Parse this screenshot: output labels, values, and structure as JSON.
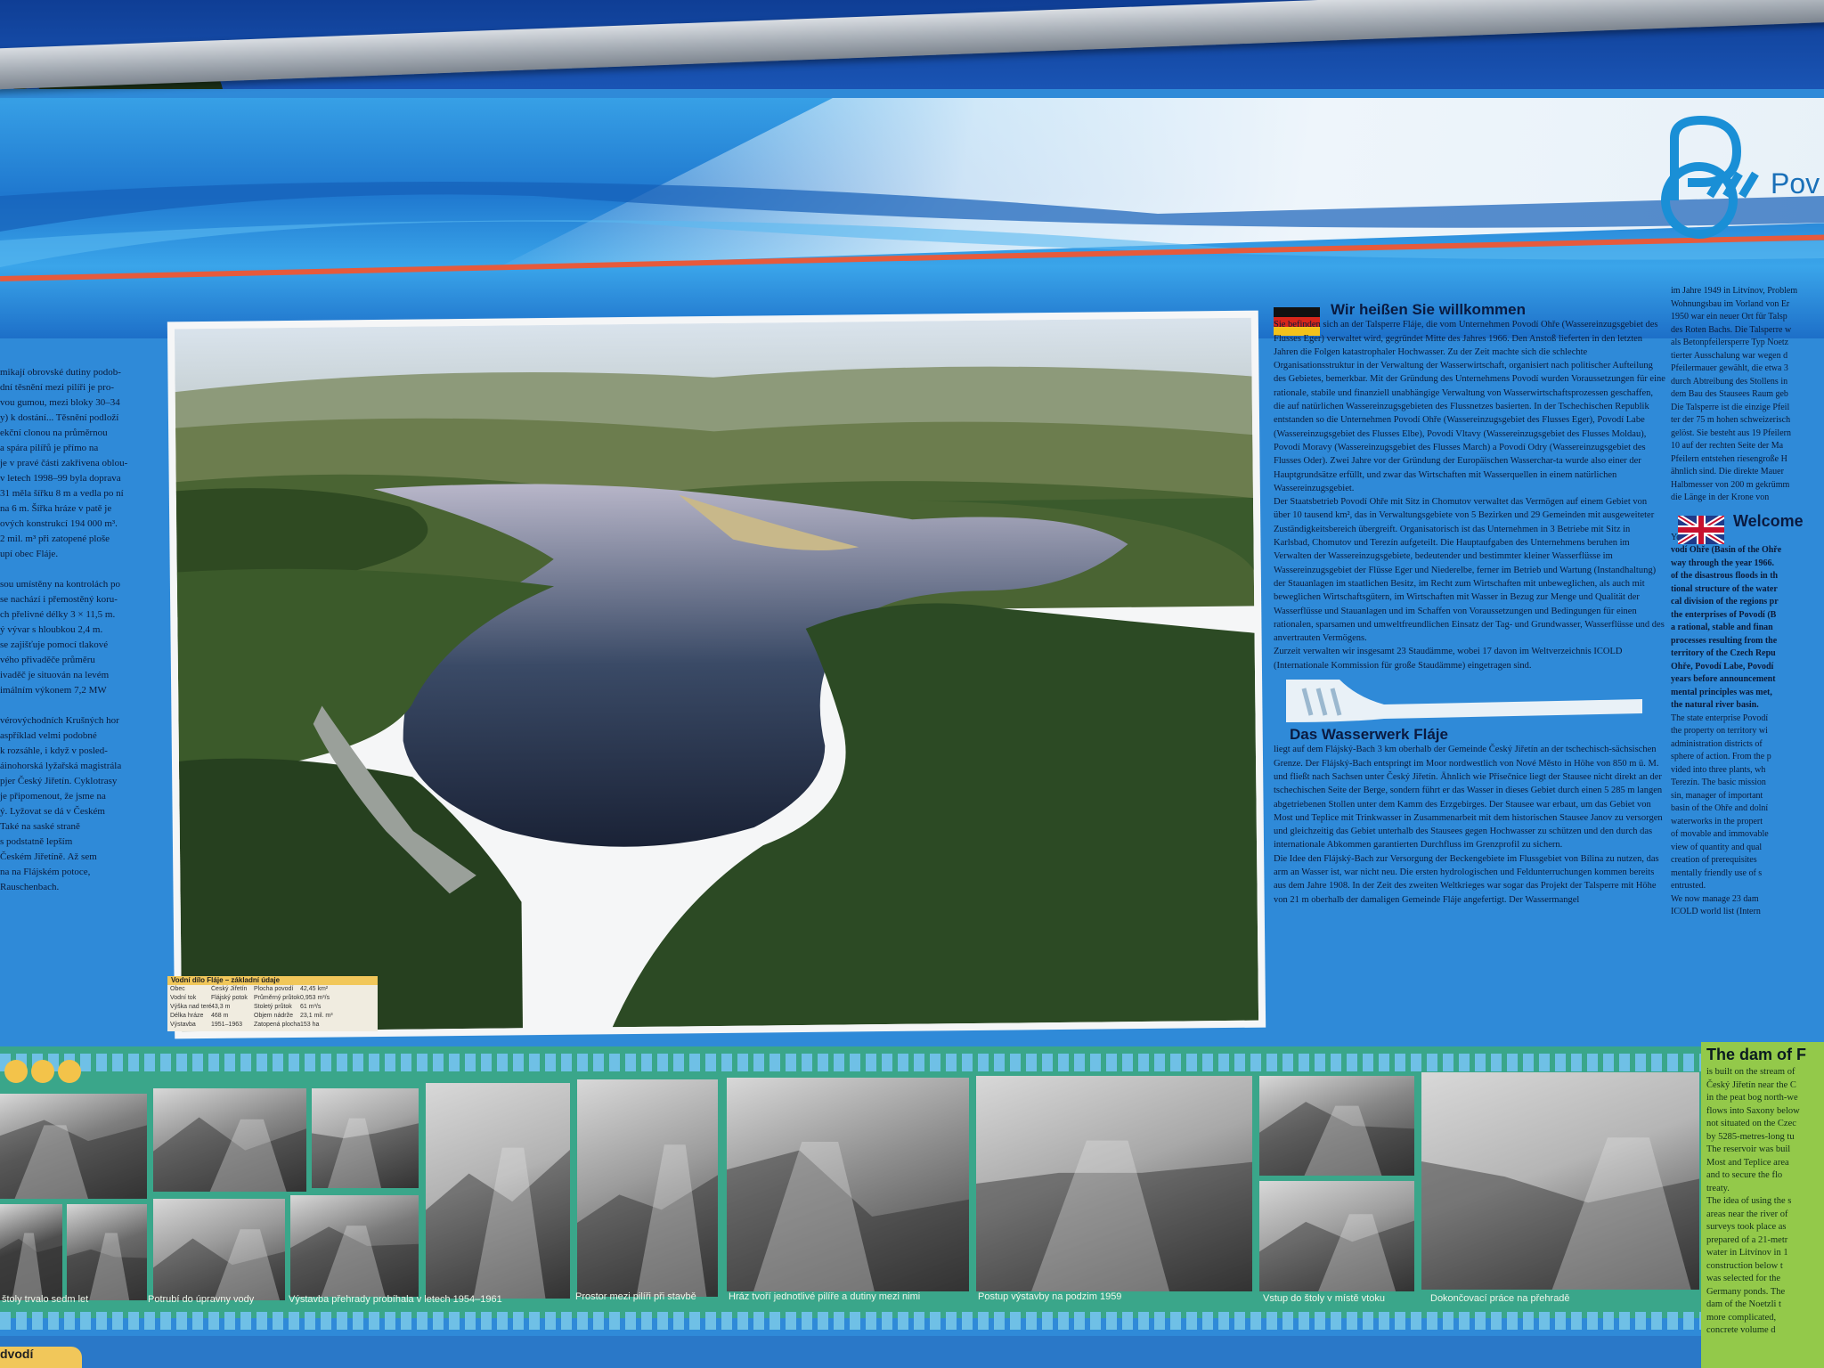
{
  "header": {
    "logo_text": "Pov"
  },
  "left_column": {
    "lines": [
      "mikají obrovské dutiny podob-",
      "dní těsnění mezi pilíři je pro-",
      "vou gumou, mezi bloky 30–34",
      "y) k dostání... Těsnění podloží",
      "ekční clonou na průměrnou",
      "a spára pilířů je přímo na",
      "je v pravé části zakřivena oblou-",
      "v letech 1998–99 byla doprava",
      "31 měla šířku 8 m a vedla po ní",
      "na 6 m. Šířka hráze v patě je",
      "ových konstrukcí 194 000 m³.",
      "2 mil. m³ při zatopené ploše",
      "upí obec Fláje.",
      "",
      "sou umístěny na kontrolách po",
      "se nachází i přemostěný koru-",
      "ch přelivné délky 3 × 11,5 m.",
      "ý vývar s hloubkou 2,4 m.",
      "se zajišťuje pomocí tlakové",
      "vého přivaděče průměru",
      "ivaděč je situován na levém",
      "imálním výkonem 7,2 MW",
      "",
      "vérovýchodních Krušných hor",
      "aspříklad velmi podobné",
      "k rozsáhle, i když v posled-",
      "áinohorská lyžařská magistrála",
      "pjer Český Jiřetín. Cyklotrasy",
      "je připomenout, že jsme na",
      "ý. Lyžovat se dá v Českém",
      "Také na saské straně",
      "s podstatně lepším",
      "Českém Jiřetíně. Až sem",
      "na na Flájském potoce,",
      "Rauschenbach."
    ]
  },
  "photo": {
    "alt": "Aerial view of Fláje reservoir and dam"
  },
  "infobox": {
    "title": "Vodní dílo Fláje – základní údaje",
    "rows": [
      [
        "Obec",
        "Český Jiřetín",
        "Plocha povodí",
        "42,45 km²"
      ],
      [
        "Vodní tok",
        "Flájský potok",
        "Průměrný průtok",
        "0,953 m³/s"
      ],
      [
        "Výška nad terénem",
        "43,3 m",
        "Stoletý průtok",
        "61 m³/s"
      ],
      [
        "Délka hráze",
        "468 m",
        "Objem nádrže",
        "23,1 mil. m³"
      ],
      [
        "Výstavba",
        "1951–1963",
        "Zatopená plocha",
        "153 ha"
      ]
    ]
  },
  "german": {
    "title": "Wir heißen Sie willkommen",
    "paragraphs": [
      "Sie befinden sich an der Talsperre Fláje, die vom Unternehmen Povodí Ohře (Wassereinzugsgebiet des Flusses Eger) verwaltet wird, gegründet Mitte des Jahres 1966. Den Anstoß lieferten in den letzten Jahren die Folgen katastrophaler Hochwasser. Zu der Zeit machte sich die schlechte Organisationsstruktur in der Verwaltung der Wasserwirtschaft, organisiert nach politischer Aufteilung des Gebietes, bemerkbar. Mit der Gründung des Unternehmens Povodí wurden Voraussetzungen für eine rationale, stabile und finanziell unabhängige Verwaltung von Wasserwirtschaftsprozessen geschaffen, die auf natürlichen Wassereinzugsgebieten des Flussnetzes basierten. In der Tschechischen Republik entstanden so die Unternehmen Povodí Ohře (Wassereinzugsgebiet des Flusses Eger), Povodí Labe (Wassereinzugsgebiet des Flusses Elbe), Povodí Vltavy (Wassereinzugsgebiet des Flusses Moldau), Povodí Moravy (Wassereinzugsgebiet des Flusses March) a Povodí Odry (Wassereinzugsgebiet des Flusses Oder). Zwei Jahre vor der Gründung der Europäischen Wasserchar-ta wurde also einer der Hauptgrundsätze erfüllt, und zwar das Wirtschaften mit Wasserquellen in einem natürlichen Wassereinzugsgebiet.",
      "Der Staatsbetrieb Povodí Ohře mit Sitz in Chomutov verwaltet das Vermögen auf einem Gebiet von über 10 tausend km², das in Verwaltungsgebiete von 5 Bezirken und 29 Gemeinden mit ausgeweiteter Zuständigkeitsbereich übergreift. Organisatorisch ist das Unternehmen in 3 Betriebe mit Sitz in Karlsbad, Chomutov und Terezín aufgeteilt. Die Hauptaufgaben des Unternehmens beruhen im Verwalten der Wassereinzugsgebiete, bedeutender und bestimmter kleiner Wasserflüsse im Wassereinzugsgebiet der Flüsse Eger und Niederelbe, ferner im Betrieb und Wartung (Instandhaltung) der Stauanlagen im staatlichen Besitz, im Recht zum Wirtschaften mit unbeweglichen, als auch mit beweglichen Wirtschaftsgütern, im Wirtschaften mit Wasser in Bezug zur Menge und Qualität der Wasserflüsse und Stauanlagen und im Schaffen von Voraussetzungen und Bedingungen für einen rationalen, sparsamen und umweltfreundlichen Einsatz der Tag- und Grundwasser, Wasserflüsse und des anvertrauten Vermögens.",
      "Zurzeit verwalten wir insgesamt 23 Staudämme, wobei 17 davon im Weltverzeichnis ICOLD (Internationale Kommission für große Staudämme) eingetragen sind."
    ],
    "subtitle": "Das Wasserwerk Fláje",
    "paragraphs2": [
      "liegt auf dem Flájský-Bach 3 km oberhalb der Gemeinde Český Jiřetín an der tschechisch-sächsischen Grenze. Der Flájský-Bach entspringt im Moor nordwestlich von Nové Město in Höhe von 850 m ü. M. und fließt nach Sachsen unter Český Jiřetín. Ähnlich wie Přísečnice liegt der Stausee nicht direkt an der tschechischen Seite der Berge, sondern führt er das Wasser in dieses Gebiet durch einen 5 285 m langen abgetriebenen Stollen unter dem Kamm des Erzgebirges. Der Stausee war erbaut, um das Gebiet von Most und Teplice mit Trinkwasser in Zusammenarbeit mit dem historischen Stausee Janov zu versorgen und gleichzeitig das Gebiet unterhalb des Stausees gegen Hochwasser zu schützen und den durch das internationale Abkommen garantierten Durchfluss im Grenzprofil zu sichern.",
      "Die Idee den Flájský-Bach zur Versorgung der Beckengebiete im Flussgebiet von Bílina zu nutzen, das arm an Wasser ist, war nicht neu. Die ersten hydrologischen und Feldunterruchungen kommen bereits aus dem Jahre 1908. In der Zeit des zweiten Weltkrieges war sogar das Projekt der Talsperre mit Höhe von 21 m oberhalb der damaligen Gemeinde Fláje angefertigt. Der Wassermangel"
    ]
  },
  "right_column": {
    "lines_top": [
      "im Jahre 1949 in Litvínov, Problem",
      "Wohnungsbau im Vorland von Er",
      "1950 war ein neuer Ort für Talsp",
      "des Roten Bachs. Die Talsperre w",
      "als Betonpfeilersperre Typ Noetz",
      "tierter Ausschalung war wegen d",
      "Pfeilermauer gewählt, die etwa 3",
      "durch Abtreibung des Stollens in",
      "dem Bau des Stausees Raum geb",
      "Die Talsperre ist die einzige Pfeil",
      "ter der 75 m hohen schweizerisch",
      "gelöst. Sie besteht aus 19 Pfeilern",
      "10 auf der rechten Seite der Ma",
      "Pfeilern entstehen riesengroße H",
      "ähnlich sind. Die direkte Mauer",
      "Halbmesser von 200 m gekrümm",
      "die Länge in der Krone von"
    ],
    "title": "Welcome",
    "lines": [
      "You are just o",
      "vodí Ohře (Basin of the Ohře",
      "way through the year 1966.",
      "of the disastrous floods in th",
      "tional structure of the water",
      "cal division of the regions pr",
      "the enterprises of Povodí (B",
      "a rational, stable and finan",
      "processes resulting from the",
      "territory of the Czech Repu",
      "Ohře, Povodí Labe, Povodí",
      "years before announcement",
      "mental principles was met,",
      "the natural river basin.",
      "The state enterprise Povodí",
      "the property on territory wi",
      "administration districts of",
      "sphere of action. From the p",
      "vided into three plants, wh",
      "Terezín. The basic mission",
      "sin, manager of important",
      "basin of the Ohře and dolní",
      "waterworks in the propert",
      "of movable and immovable",
      "view of quantity and qual",
      "creation of prerequisites",
      "mentally friendly use of s",
      "entrusted.",
      "We now manage 23 dam",
      "ICOLD world list (Intern"
    ]
  },
  "film": {
    "captions": [
      "štoly trvalo sedm let",
      "Potrubí do úpravny vody",
      "Výstavba přehrady probíhala v letech 1954–1961",
      "Prostor mezi pilíři při stavbě",
      "Hráz tvoří jednotlivé pilíře a dutiny mezi nimi",
      "Postup výstavby na podzim 1959",
      "Vstup do štoly v místě vtoku",
      "Dokončovací práce na přehradě"
    ]
  },
  "dam_panel": {
    "title": "The dam of F",
    "lines": [
      "is built on the stream of",
      "Český Jiřetín near the C",
      "in the peat bog north-we",
      "flows into Saxony below",
      "not situated on the Czec",
      "by 5285-metres-long tu",
      "The reservoir was buil",
      "Most and Teplice area",
      "and to secure the flo",
      "treaty.",
      "The idea of using the s",
      "areas near the river of",
      "surveys took place as",
      "prepared of a 21-metr",
      "water in Litvínov in 1",
      "construction below t",
      "was selected for the",
      "Germany ponds. The",
      "dam of the Noetzli t",
      "more complicated,",
      "concrete volume d"
    ]
  },
  "bottom": {
    "tag": "dvodí"
  }
}
